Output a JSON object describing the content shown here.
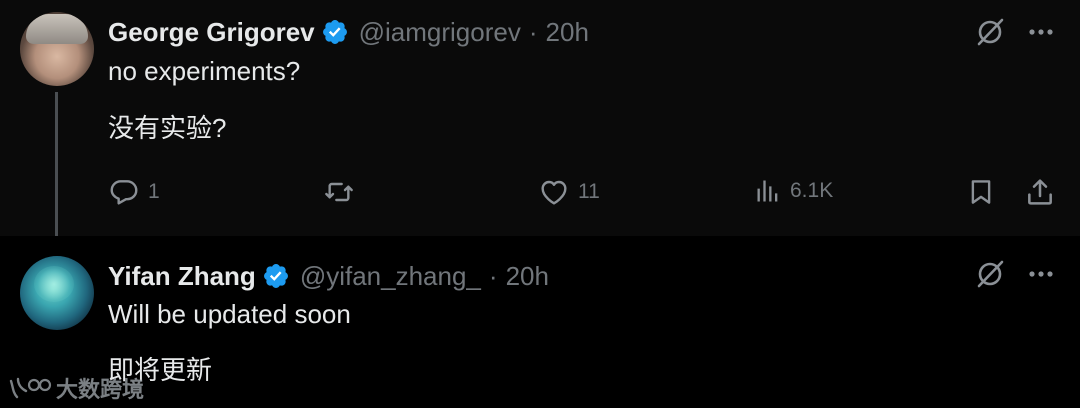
{
  "tweets": [
    {
      "author_name": "George Grigorev",
      "handle": "@iamgrigorev",
      "separator": "·",
      "time": "20h",
      "lines": [
        "no experiments?",
        "没有实验?"
      ],
      "actions": {
        "replies": "1",
        "retweets": "",
        "likes": "11",
        "views": "6.1K"
      }
    },
    {
      "author_name": "Yifan Zhang",
      "handle": "@yifan_zhang_",
      "separator": "·",
      "time": "20h",
      "lines": [
        "Will be updated soon",
        "即将更新"
      ]
    }
  ],
  "watermark": {
    "text": "大数跨境"
  },
  "colors": {
    "background": "#000000",
    "thread_bg": "#0a0a0a",
    "primary_text": "#e7e9ea",
    "secondary_text": "#71767b",
    "verified_blue": "#1d9bf0"
  },
  "icons": [
    "verified-badge-icon",
    "grok-icon",
    "more-icon",
    "reply-icon",
    "retweet-icon",
    "like-icon",
    "views-icon",
    "bookmark-icon",
    "share-icon"
  ]
}
